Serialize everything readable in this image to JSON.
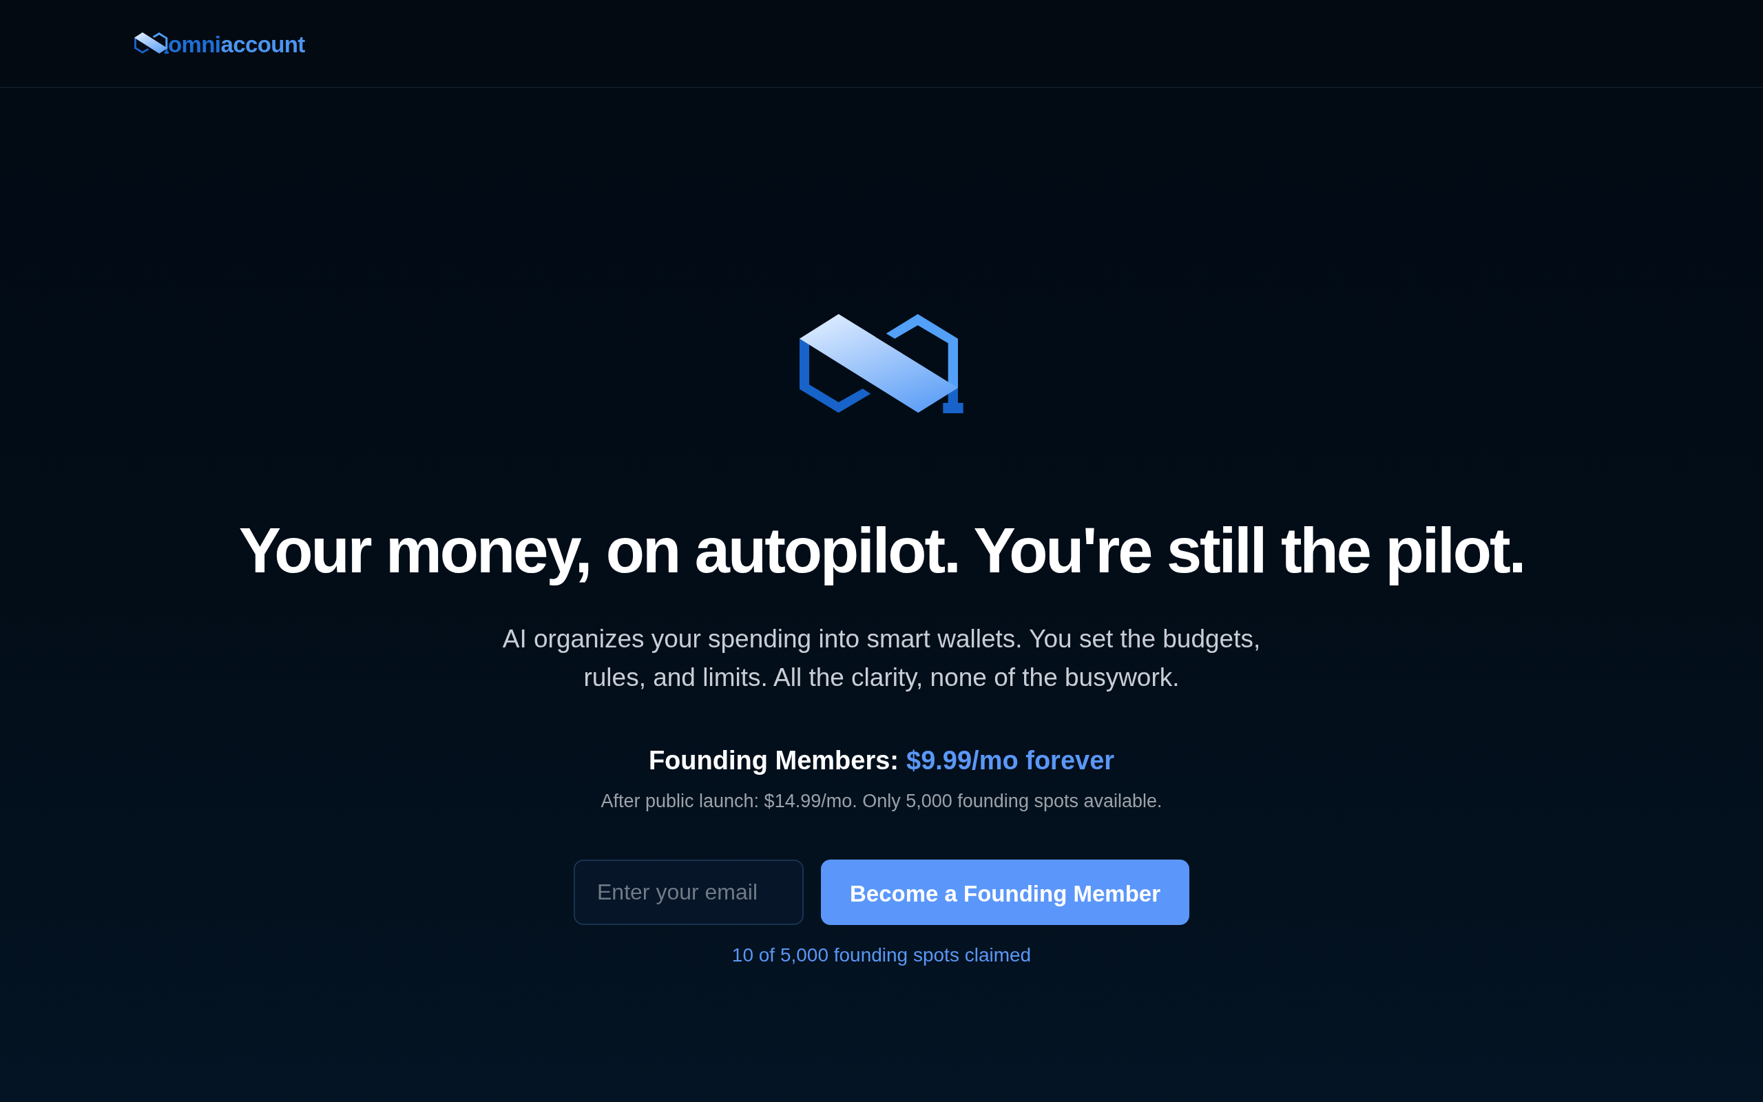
{
  "header": {
    "logo": {
      "part_1": "omni",
      "part_2": "account"
    }
  },
  "hero": {
    "headline": "Your money, on autopilot. You're still the pilot.",
    "subheadline": "AI organizes your spending into smart wallets. You set the budgets, rules, and limits. All the clarity, none of the busywork.",
    "offer": {
      "label": "Founding Members:",
      "price": "$9.99/mo forever",
      "note": "After public launch: $14.99/mo. Only 5,000 founding spots available."
    },
    "signup": {
      "email_field": {
        "placeholder": "Enter your email"
      },
      "button": "Become a Founding Member",
      "claimed": "10 of 5,000 founding spots claimed"
    }
  }
}
